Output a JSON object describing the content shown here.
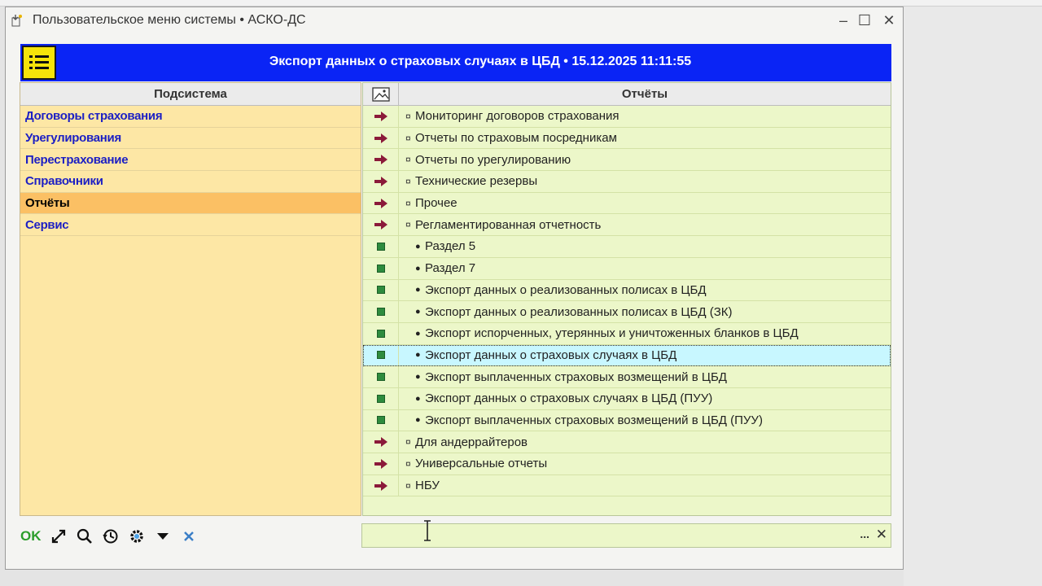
{
  "window": {
    "title": "Пользовательское меню системы • АСКО-ДС",
    "minimize": "–",
    "maximize": "☐",
    "close": "✕"
  },
  "header": {
    "title": "Экспорт данных о страховых случаях в ЦБД • 15.12.2025 11:11:55"
  },
  "left": {
    "column_title": "Подсистема",
    "items": [
      {
        "label": "Договоры страхования",
        "active": false
      },
      {
        "label": "Урегулирования",
        "active": false
      },
      {
        "label": "Перестрахование",
        "active": false
      },
      {
        "label": "Справочники",
        "active": false
      },
      {
        "label": "Отчёты",
        "active": true
      },
      {
        "label": "Сервис",
        "active": false
      }
    ]
  },
  "right": {
    "column_title": "Отчёты",
    "rows": [
      {
        "type": "group",
        "label": "Мониторинг договоров страхования"
      },
      {
        "type": "group",
        "label": "Отчеты по страховым посредникам"
      },
      {
        "type": "group",
        "label": "Отчеты по урегулированию"
      },
      {
        "type": "group",
        "label": "Технические резервы"
      },
      {
        "type": "group",
        "label": "Прочее"
      },
      {
        "type": "group",
        "label": "Регламентированная отчетность"
      },
      {
        "type": "item",
        "label": "Раздел 5"
      },
      {
        "type": "item",
        "label": "Раздел 7"
      },
      {
        "type": "item",
        "label": "Экспорт данных о реализованных полисах в ЦБД"
      },
      {
        "type": "item",
        "label": "Экспорт данных о реализованных полисах в ЦБД (ЗК)"
      },
      {
        "type": "item",
        "label": "Экспорт испорченных, утерянных и уничтоженных бланков в ЦБД"
      },
      {
        "type": "item",
        "label": "Экспорт данных о страховых случаях в ЦБД",
        "selected": true
      },
      {
        "type": "item",
        "label": "Экспорт выплаченных страховых возмещений в ЦБД"
      },
      {
        "type": "item",
        "label": "Экспорт данных о страховых случаях в ЦБД (ПУУ)"
      },
      {
        "type": "item",
        "label": "Экспорт выплаченных страховых возмещений в ЦБД (ПУУ)"
      },
      {
        "type": "group",
        "label": "Для андеррайтеров"
      },
      {
        "type": "group",
        "label": "Универсальные отчеты"
      },
      {
        "type": "group",
        "label": "НБУ"
      }
    ]
  },
  "toolbar": {
    "ok_label": "OK"
  },
  "search": {
    "value": "",
    "dots": "...",
    "clear": "✕"
  },
  "icons": {
    "menu": "list-icon",
    "arrow": "arrow-right-icon",
    "square": "report-square-icon",
    "picture": "picture-icon"
  },
  "colors": {
    "header_bg": "#0a24f5",
    "left_bg": "#fde7a5",
    "left_active": "#fbc064",
    "right_bg": "#ecf7c9",
    "selected_row": "#c8f7ff",
    "link_text": "#1c1fc4",
    "arrow": "#8b1a3a"
  }
}
